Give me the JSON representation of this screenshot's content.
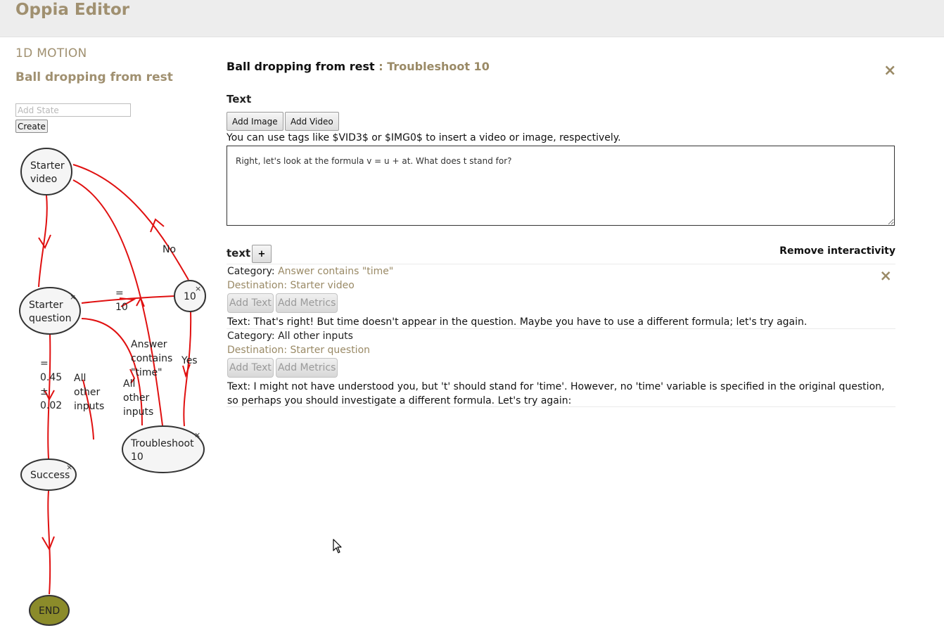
{
  "header": {
    "app_title": "Oppia Editor"
  },
  "sidebar": {
    "category": "1D MOTION",
    "exploration_title": "Ball dropping from rest",
    "add_state_placeholder": "Add State",
    "create_label": "Create"
  },
  "graph": {
    "nodes": {
      "starter_video": [
        "Starter",
        "video"
      ],
      "starter_question": [
        "Starter",
        "question"
      ],
      "ten": "10",
      "troubleshoot": [
        "Troubleshoot",
        "10"
      ],
      "success": "Success",
      "end": "END"
    },
    "delete_glyph": "×",
    "edge_labels": {
      "no": "No",
      "eq_10": [
        "=",
        "10"
      ],
      "range": [
        "=",
        "0.45",
        "±",
        "0.02"
      ],
      "all_other_left": [
        "All",
        "other",
        "inputs"
      ],
      "answer_contains": [
        "Answer",
        "contains",
        "\"time\""
      ],
      "all_other_mid": [
        "All",
        "other",
        "inputs"
      ],
      "yes": "Yes"
    },
    "colors": {
      "edge": "#e01010",
      "node_fill": "#f5f5f5",
      "node_stroke": "#333333",
      "end_fill": "#8b8b2a"
    }
  },
  "state_editor": {
    "exploration_title": "Ball dropping from rest",
    "separator": " : ",
    "state_name": "Troubleshoot 10",
    "close_glyph": "×",
    "text_label": "Text",
    "add_image_label": "Add Image",
    "add_video_label": "Add Video",
    "hint": "You can use tags like $VID3$ or $IMG0$ to insert a video or image, respectively.",
    "content": "Right, let's look at the formula v = u + at. What does t stand for?",
    "interaction_label": "text",
    "plus_label": "+",
    "remove_interactivity_label": "Remove interactivity"
  },
  "rules": [
    {
      "category_prefix": "Category: ",
      "category": "Answer contains \"time\"",
      "destination": "Destination: Starter video",
      "add_text_label": "Add Text",
      "add_metrics_label": "Add Metrics",
      "text": "Text: That's right! But time doesn't appear in the question. Maybe you have to use a different formula; let's try again.",
      "close_glyph": "×"
    },
    {
      "category_prefix": "Category: ",
      "category": "All other inputs",
      "destination": "Destination: Starter question",
      "add_text_label": "Add Text",
      "add_metrics_label": "Add Metrics",
      "text": "Text: I might not have understood you, but 't' should stand for 'time'. However, no 'time' variable is specified in the original question, so perhaps you should investigate a different formula. Let's try again:"
    }
  ]
}
